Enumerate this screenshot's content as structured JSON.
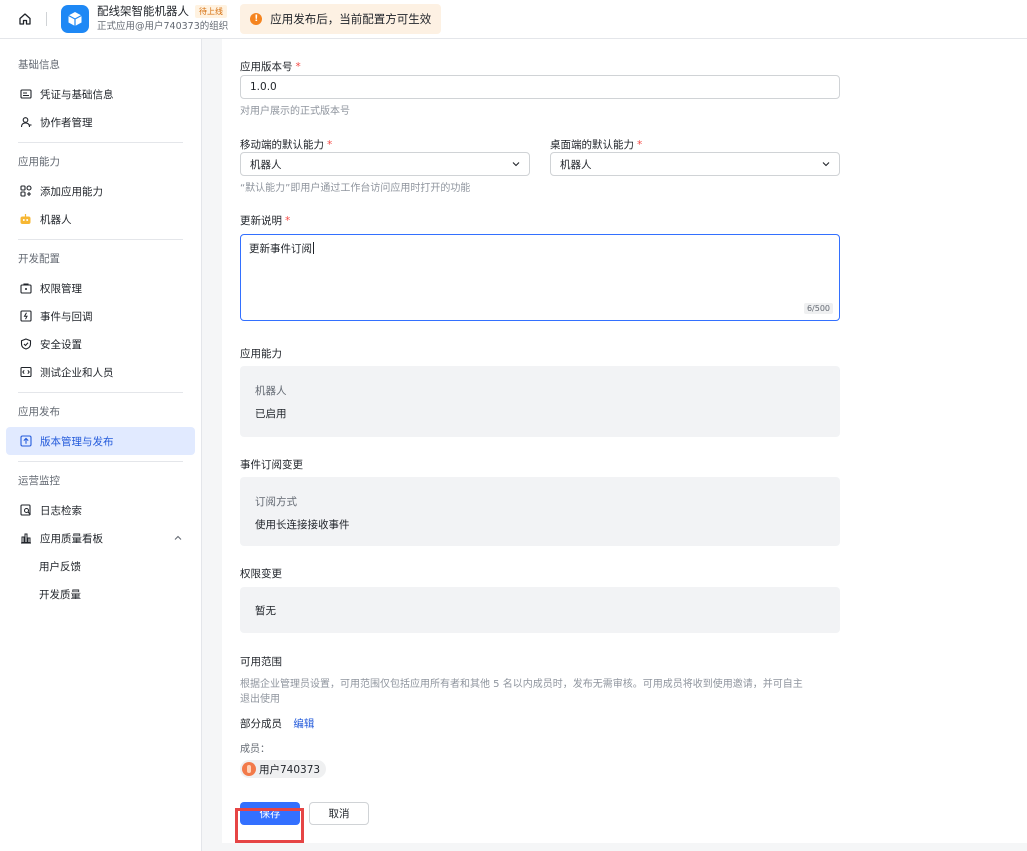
{
  "topbar": {
    "app_name": "配线架智能机器人",
    "status_tag": "待上线",
    "org_text": "正式应用@用户740373的组织",
    "notice_text": "应用发布后，当前配置方可生效"
  },
  "sidebar": {
    "groups": [
      {
        "title": "基础信息",
        "items": [
          {
            "label": "凭证与基础信息",
            "icon": "id-card-icon"
          },
          {
            "label": "协作者管理",
            "icon": "user-icon"
          }
        ]
      },
      {
        "title": "应用能力",
        "items": [
          {
            "label": "添加应用能力",
            "icon": "add-grid-icon"
          },
          {
            "label": "机器人",
            "icon": "robot-icon"
          }
        ]
      },
      {
        "title": "开发配置",
        "items": [
          {
            "label": "权限管理",
            "icon": "lock-box-icon"
          },
          {
            "label": "事件与回调",
            "icon": "event-icon"
          },
          {
            "label": "安全设置",
            "icon": "shield-icon"
          },
          {
            "label": "测试企业和人员",
            "icon": "test-icon"
          }
        ]
      },
      {
        "title": "应用发布",
        "items": [
          {
            "label": "版本管理与发布",
            "icon": "upload-icon",
            "active": true
          }
        ]
      },
      {
        "title": "运营监控",
        "items": [
          {
            "label": "日志检索",
            "icon": "log-search-icon"
          },
          {
            "label": "应用质量看板",
            "icon": "bar-chart-icon",
            "expanded": true
          },
          {
            "label": "用户反馈",
            "sub": true
          },
          {
            "label": "开发质量",
            "sub": true
          }
        ]
      }
    ]
  },
  "form": {
    "version_label": "应用版本号",
    "version_value": "1.0.0",
    "version_hint": "对用户展示的正式版本号",
    "mobile_label": "移动端的默认能力",
    "mobile_value": "机器人",
    "desktop_label": "桌面端的默认能力",
    "desktop_value": "机器人",
    "capability_hint": "“默认能力”即用户通过工作台访问应用时打开的功能",
    "notes_label": "更新说明",
    "notes_value": "更新事件订阅",
    "notes_counter": "6/500",
    "abilities_label": "应用能力",
    "abilities_name": "机器人",
    "abilities_status": "已启用",
    "events_label": "事件订阅变更",
    "events_key": "订阅方式",
    "events_value": "使用长连接接收事件",
    "perm_label": "权限变更",
    "perm_value": "暂无",
    "scope_label": "可用范围",
    "scope_desc_line1": "根据企业管理员设置，可用范围仅包括应用所有者和其他 5 名以内成员时，发布无需审核。可用成员将收到使用邀请，并可自主",
    "scope_desc_line2": "退出使用",
    "scope_mode": "部分成员",
    "scope_edit": "编辑",
    "members_label": "成员：",
    "member_name": "用户740373",
    "save_label": "保存",
    "cancel_label": "取消"
  }
}
